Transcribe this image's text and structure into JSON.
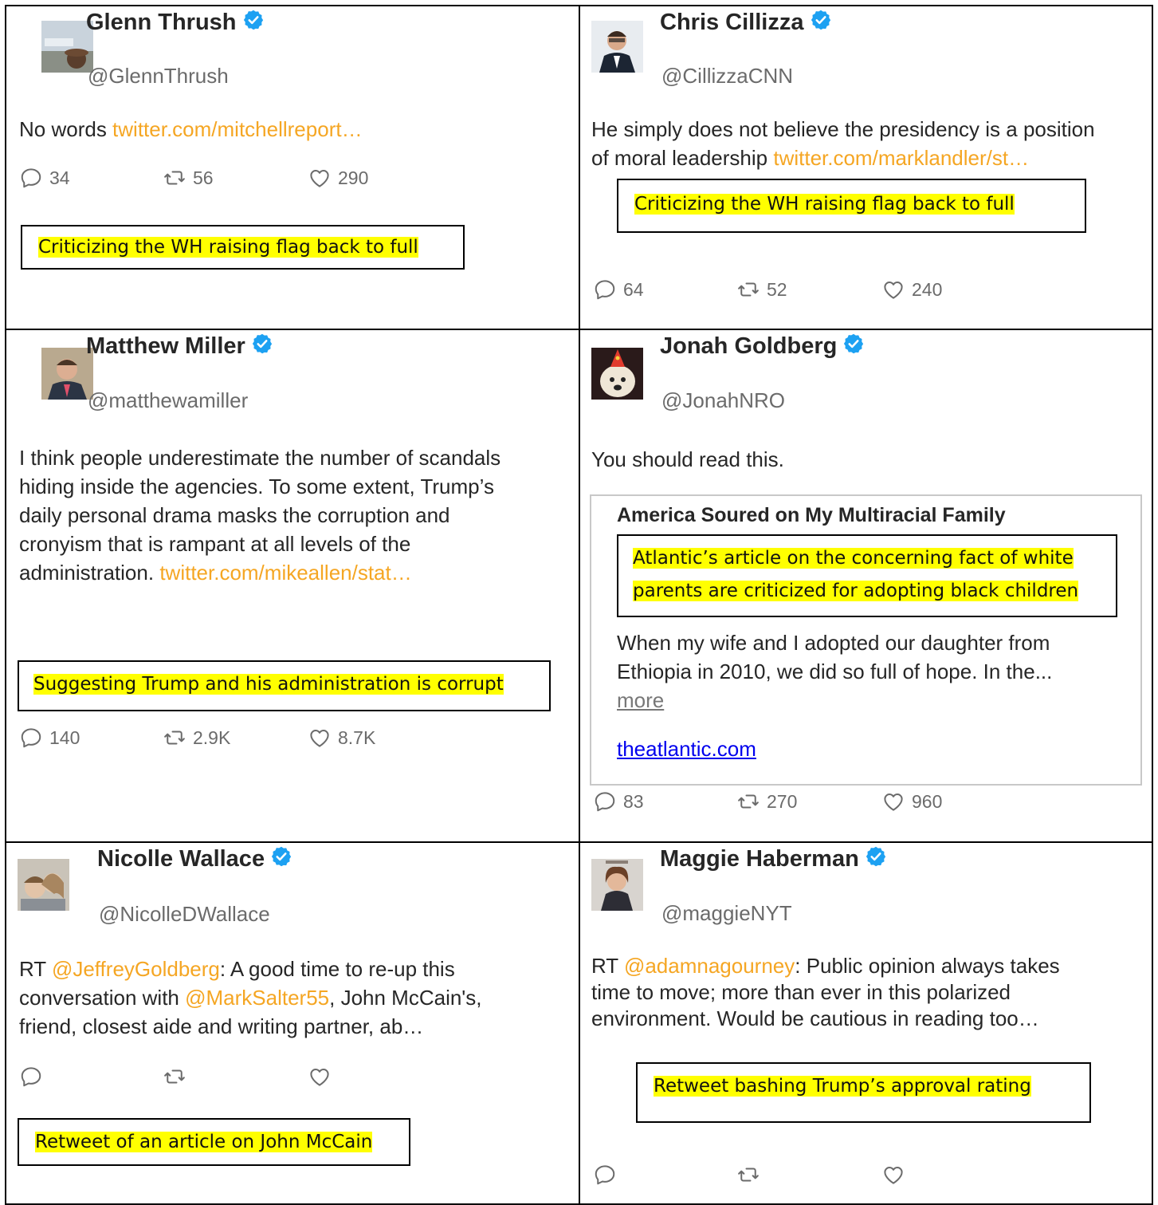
{
  "tweets": [
    {
      "name": "Glenn Thrush",
      "handle": "@GlennThrush",
      "text_prefix": "No words ",
      "link": "twitter.com/mitchellreport…",
      "replies": "34",
      "retweets": "56",
      "likes": "290",
      "annotation": "Criticizing the WH raising flag back to full"
    },
    {
      "name": "Chris Cillizza",
      "handle": "@CillizzaCNN",
      "text_line1": "He simply does not believe the presidency is a position",
      "text_line2_prefix": "of moral leadership ",
      "link": "twitter.com/marklandler/st…",
      "replies": "64",
      "retweets": "52",
      "likes": "240",
      "annotation": "Criticizing the WH raising flag back to full"
    },
    {
      "name": "Matthew Miller",
      "handle": "@matthewamiller",
      "lines": [
        "I think people underestimate the number of scandals",
        "hiding inside the agencies. To some extent, Trump’s",
        "daily personal drama masks the corruption and",
        "cronyism that is rampant at all levels of the"
      ],
      "last_line_prefix": "administration. ",
      "link": "twitter.com/mikeallen/stat…",
      "replies": "140",
      "retweets": "2.9K",
      "likes": "8.7K",
      "annotation": "Suggesting Trump and his administration is corrupt"
    },
    {
      "name": "Jonah Goldberg",
      "handle": "@JonahNRO",
      "text": "You should read this.",
      "card": {
        "title": "America Soured on My Multiracial Family",
        "annotation_line1": "Atlantic’s article on the concerning fact of white",
        "annotation_line2": "parents are criticized for adopting black children",
        "text_line1": "When my wife and I adopted our daughter from",
        "text_line2": "Ethiopia in 2010, we did so full of hope. In the...",
        "more": "more",
        "domain": "theatlantic.com"
      },
      "replies": "83",
      "retweets": "270",
      "likes": "960"
    },
    {
      "name": "Nicolle Wallace",
      "handle": "@NicolleDWallace",
      "rt": "RT ",
      "mention1": "@JeffreyGoldberg",
      "line1_rest": ": A good time to re-up this",
      "line2_prefix": "conversation with ",
      "mention2": "@MarkSalter55",
      "line2_rest": ", John McCain's,",
      "line3": "friend, closest aide and writing partner, ab…",
      "annotation": "Retweet of an article on John McCain"
    },
    {
      "name": "Maggie Haberman",
      "handle": "@maggieNYT",
      "rt": "RT ",
      "mention1": "@adamnagourney",
      "line1_rest": ": Public opinion always takes",
      "line2": "time to move; more than ever in this polarized",
      "line3": "environment. Would be cautious in reading too…",
      "annotation": "Retweet bashing Trump’s approval rating"
    }
  ],
  "colors": {
    "link": "#f5a623",
    "highlight": "#ffff00",
    "verified": "#1da1f2",
    "border": "#000000"
  },
  "icons": [
    "verified-badge-icon",
    "reply-icon",
    "retweet-icon",
    "like-icon"
  ]
}
